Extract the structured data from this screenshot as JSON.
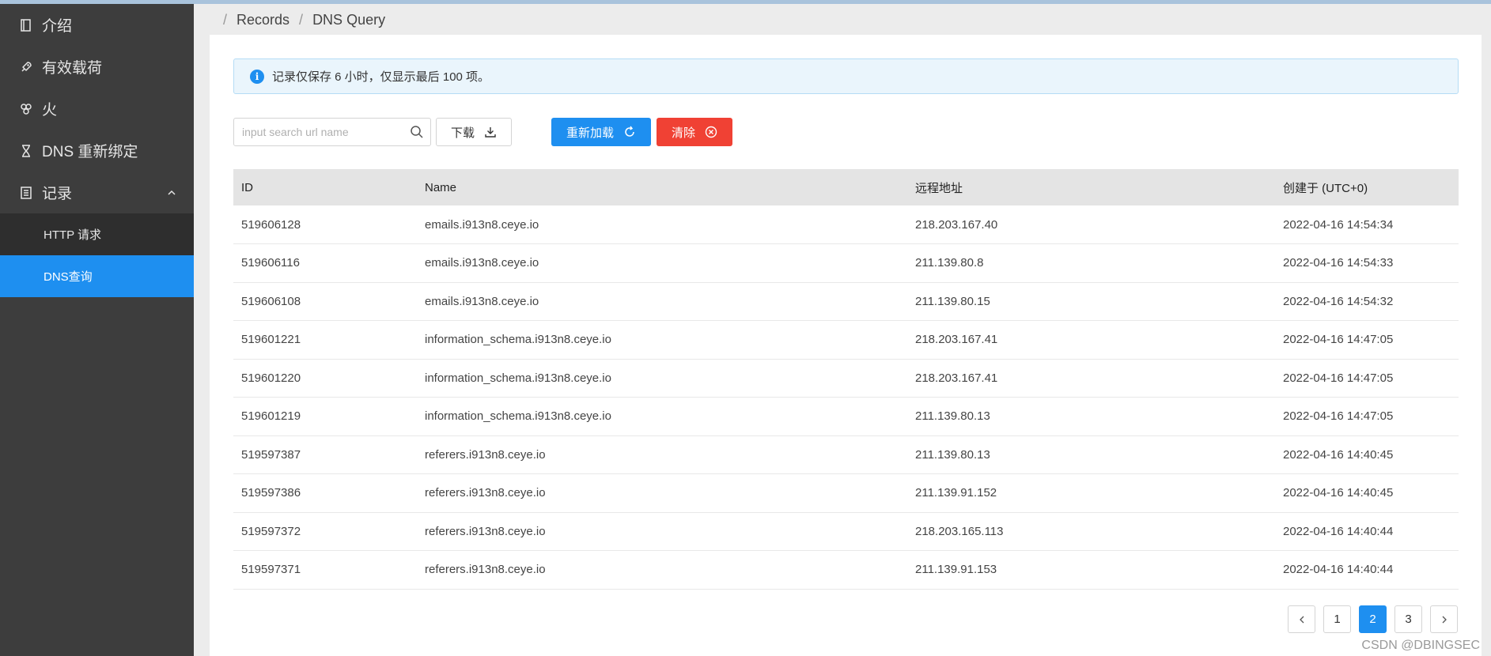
{
  "sidebar": {
    "items": [
      {
        "label": "介绍",
        "icon": "book-icon"
      },
      {
        "label": "有效载荷",
        "icon": "rocket-icon"
      },
      {
        "label": "火",
        "icon": "fire-icon"
      },
      {
        "label": "DNS 重新绑定",
        "icon": "hourglass-icon"
      },
      {
        "label": "记录",
        "icon": "list-icon"
      }
    ],
    "sub_items": [
      {
        "label": "HTTP 请求"
      },
      {
        "label": "DNS查询"
      }
    ]
  },
  "breadcrumb": {
    "first": "Records",
    "second": "DNS Query"
  },
  "alert": {
    "icon": "i",
    "text": "记录仅保存 6 小时，仅显示最后 100 项。"
  },
  "toolbar": {
    "search_placeholder": "input search url name",
    "download_label": "下载",
    "reload_label": "重新加载",
    "clear_label": "清除"
  },
  "table": {
    "headers": [
      "ID",
      "Name",
      "远程地址",
      "创建于 (UTC+0)"
    ],
    "rows": [
      [
        "519606128",
        "emails.i913n8.ceye.io",
        "218.203.167.40",
        "2022-04-16 14:54:34"
      ],
      [
        "519606116",
        "emails.i913n8.ceye.io",
        "211.139.80.8",
        "2022-04-16 14:54:33"
      ],
      [
        "519606108",
        "emails.i913n8.ceye.io",
        "211.139.80.15",
        "2022-04-16 14:54:32"
      ],
      [
        "519601221",
        "information_schema.i913n8.ceye.io",
        "218.203.167.41",
        "2022-04-16 14:47:05"
      ],
      [
        "519601220",
        "information_schema.i913n8.ceye.io",
        "218.203.167.41",
        "2022-04-16 14:47:05"
      ],
      [
        "519601219",
        "information_schema.i913n8.ceye.io",
        "211.139.80.13",
        "2022-04-16 14:47:05"
      ],
      [
        "519597387",
        "referers.i913n8.ceye.io",
        "211.139.80.13",
        "2022-04-16 14:40:45"
      ],
      [
        "519597386",
        "referers.i913n8.ceye.io",
        "211.139.91.152",
        "2022-04-16 14:40:45"
      ],
      [
        "519597372",
        "referers.i913n8.ceye.io",
        "218.203.165.113",
        "2022-04-16 14:40:44"
      ],
      [
        "519597371",
        "referers.i913n8.ceye.io",
        "211.139.91.153",
        "2022-04-16 14:40:44"
      ]
    ]
  },
  "pagination": {
    "pages": [
      "1",
      "2",
      "3"
    ],
    "current": "2"
  },
  "watermark": "CSDN @DBINGSEC",
  "colors": {
    "accent": "#1e8ff0",
    "danger": "#f04134",
    "sidebar": "#3d3d3d"
  }
}
